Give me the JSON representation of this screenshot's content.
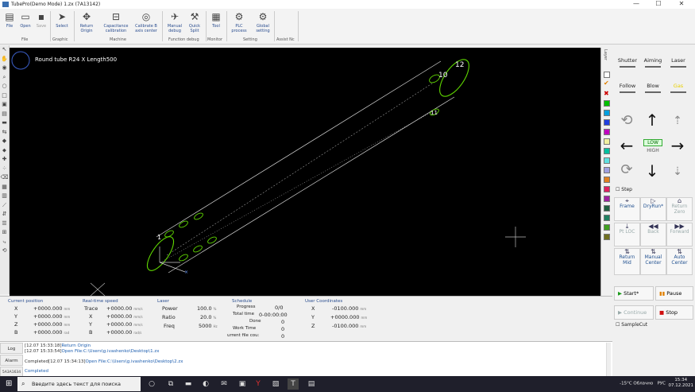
{
  "window": {
    "title": "TubePro(Demo Mode) 1.zx (7A13142)",
    "min": "—",
    "max": "☐",
    "close": "✕"
  },
  "ribbon": {
    "buttons": [
      {
        "label": "File",
        "name": "file-button",
        "icon": "▤"
      },
      {
        "label": "Open",
        "name": "open-button",
        "icon": "📂"
      },
      {
        "label": "Save",
        "name": "save-button",
        "icon": "💾"
      },
      {
        "label": "Select",
        "name": "select-button",
        "icon": "➤"
      },
      {
        "label": "Return\nOrigin",
        "name": "return-origin-button",
        "icon": "✥"
      },
      {
        "label": "Capacitance\ncalibration",
        "name": "capacitance-calibration-button",
        "icon": "⊟"
      },
      {
        "label": "Calibrate B\naxis center",
        "name": "calibrate-b-axis-button",
        "icon": "◎"
      },
      {
        "label": "Manual\ndebug",
        "name": "manual-debug-button",
        "icon": "✈"
      },
      {
        "label": "Quick\nSplit",
        "name": "quick-split-button",
        "icon": "⚒"
      },
      {
        "label": "Tool",
        "name": "tool-button",
        "icon": "📈"
      },
      {
        "label": "PLC\nprocess",
        "name": "plc-process-button",
        "icon": "⚙"
      },
      {
        "label": "Global\nsetting",
        "name": "global-setting-button",
        "icon": "⚙"
      }
    ],
    "groups": [
      "File",
      "Graphic",
      "Machine",
      "Function debug",
      "Monitor",
      "Setting",
      "Assist Nc"
    ]
  },
  "canvas": {
    "shape_label": "Round tube R24 X Length500",
    "point_labels": [
      "12",
      "10",
      "11",
      "1"
    ]
  },
  "right_panel": {
    "top_buttons": [
      "Shutter",
      "Aiming",
      "Laser",
      "Follow",
      "Blow",
      "Gas"
    ],
    "speed": "LOW",
    "speed2": "HIGH",
    "step_label": "Step",
    "motion": [
      {
        "label": "Frame",
        "icon": "⌖"
      },
      {
        "label": "DryRun*",
        "icon": "▷"
      },
      {
        "label": "Return\nZero",
        "icon": "⌂",
        "disabled": true
      },
      {
        "label": "Pt LOC",
        "icon": "⤓",
        "disabled": true
      },
      {
        "label": "Back",
        "icon": "◀◀",
        "disabled": true
      },
      {
        "label": "Forward",
        "icon": "▶▶",
        "disabled": true
      },
      {
        "label": "Return\nMid",
        "icon": "⇅"
      },
      {
        "label": "Manual\nCenter",
        "icon": "⇅"
      },
      {
        "label": "Auto\nCenter",
        "icon": "⇅"
      }
    ],
    "start": "Start*",
    "pause": "Pause",
    "continue": "Continue",
    "stop": "Stop",
    "samplecut": "SampleCut"
  },
  "status": {
    "current_position": {
      "title": "Current position",
      "rows": [
        [
          "X",
          "+0000.000",
          "mm"
        ],
        [
          "Y",
          "+0000.000",
          "mm"
        ],
        [
          "Z",
          "+0000.000",
          "mm"
        ],
        [
          "B",
          "+0000.000",
          "rad"
        ]
      ]
    },
    "realtime_speed": {
      "title": "Real-time speed",
      "rows": [
        [
          "Trace",
          "+0000.00",
          "mm/s"
        ],
        [
          "X",
          "+0000.00",
          "mm/s"
        ],
        [
          "Y",
          "+0000.00",
          "mm/s"
        ],
        [
          "B",
          "+0000.00",
          "rad/s"
        ]
      ]
    },
    "laser": {
      "title": "Laser",
      "rows": [
        [
          "Power",
          "100.0",
          "%"
        ],
        [
          "Ratio",
          "20.0",
          "%"
        ],
        [
          "Freq",
          "5000",
          "Hz"
        ]
      ]
    },
    "schedule": {
      "title": "Schedule",
      "rows": [
        [
          "Progress",
          "0/0"
        ],
        [
          "Total time",
          "0-00:00:00"
        ],
        [
          "Done",
          "0"
        ],
        [
          "Work Time",
          "0"
        ],
        [
          "urrent file cou:",
          "0"
        ]
      ]
    },
    "user_coordinates": {
      "title": "User Coordinates",
      "rows": [
        [
          "X",
          "-0100.000",
          "mm"
        ],
        [
          "Y",
          "+0000.000",
          "mm"
        ],
        [
          "Z",
          "-0100.000",
          "mm"
        ]
      ]
    }
  },
  "log": {
    "tabs": [
      "Log",
      "Alarm",
      "5A3A1634"
    ],
    "lines": [
      {
        "ts": "[12.07 15:33:18]",
        "msg": "Return Origin"
      },
      {
        "ts": "[12.07 15:33:54]",
        "msg": "Open File:C:\\Users\\g.ivashenko\\Desktop\\1.zx"
      },
      {
        "ts": "Completed[12.07 15:34:13]",
        "msg": "Open File:C:\\Users\\g.ivashenko\\Desktop\\2.zx"
      },
      {
        "ts": "",
        "msg": "Completed"
      }
    ]
  },
  "taskbar": {
    "search": "Введите здесь текст для поиска",
    "weather": "-15°C Облачно",
    "lang": "РУС",
    "time": "15:34",
    "date": "07.12.2021"
  },
  "colors": {
    "accent": "#2a4d8f",
    "tube": "#7fd600",
    "canvas": "#000000"
  }
}
